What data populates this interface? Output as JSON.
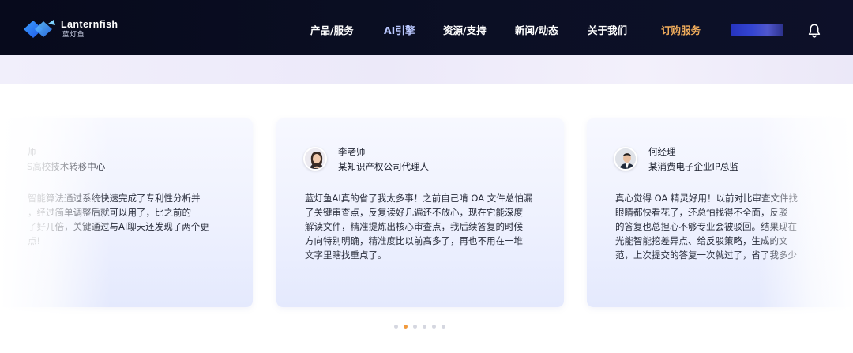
{
  "brand": {
    "name": "Lanternfish",
    "sub": "蓝灯鱼",
    "color": "#2f7df6"
  },
  "nav": {
    "items": [
      {
        "label": "产品/服务"
      },
      {
        "label": "AI引擎"
      },
      {
        "label": "资源/支持"
      },
      {
        "label": "新闻/动态"
      },
      {
        "label": "关于我们"
      },
      {
        "label": "订购服务"
      }
    ],
    "bell_icon": "bell-icon"
  },
  "testimonials": [
    {
      "name": "师",
      "title": "S高校技术转移中心",
      "quote": [
        "智能算法通过系统快速完成了专利性分析并",
        "，经过简单调整后就可以用了，比之前的",
        "了好几倍，关键通过与AI聊天还发现了两个更",
        "点!"
      ]
    },
    {
      "name": "李老师",
      "title": "某知识产权公司代理人",
      "quote": [
        "蓝灯鱼AI真的省了我太多事！之前自己啃 OA 文件总怕漏",
        "了关键审查点，反复读好几遍还不放心，现在它能深度",
        "解读文件，精准提炼出核心审查点，我后续答复的时候",
        "方向特别明确，精准度比以前高多了，再也不用在一堆",
        "文字里瞎找重点了。"
      ]
    },
    {
      "name": "何经理",
      "title": "某消费电子企业IP总监",
      "quote": [
        "真心觉得 OA 精灵好用！以前对比审查文件找",
        "眼睛都快看花了，还总怕找得不全面，反驳",
        "的答复也总担心不够专业会被驳回。结果现在",
        "光能智能挖差异点、给反驳策略，生成的文",
        "范，上次提交的答复一次就过了，省了我多少"
      ]
    }
  ],
  "pagination": {
    "count": 6,
    "active": 1,
    "active_color": "#f19a3e"
  }
}
